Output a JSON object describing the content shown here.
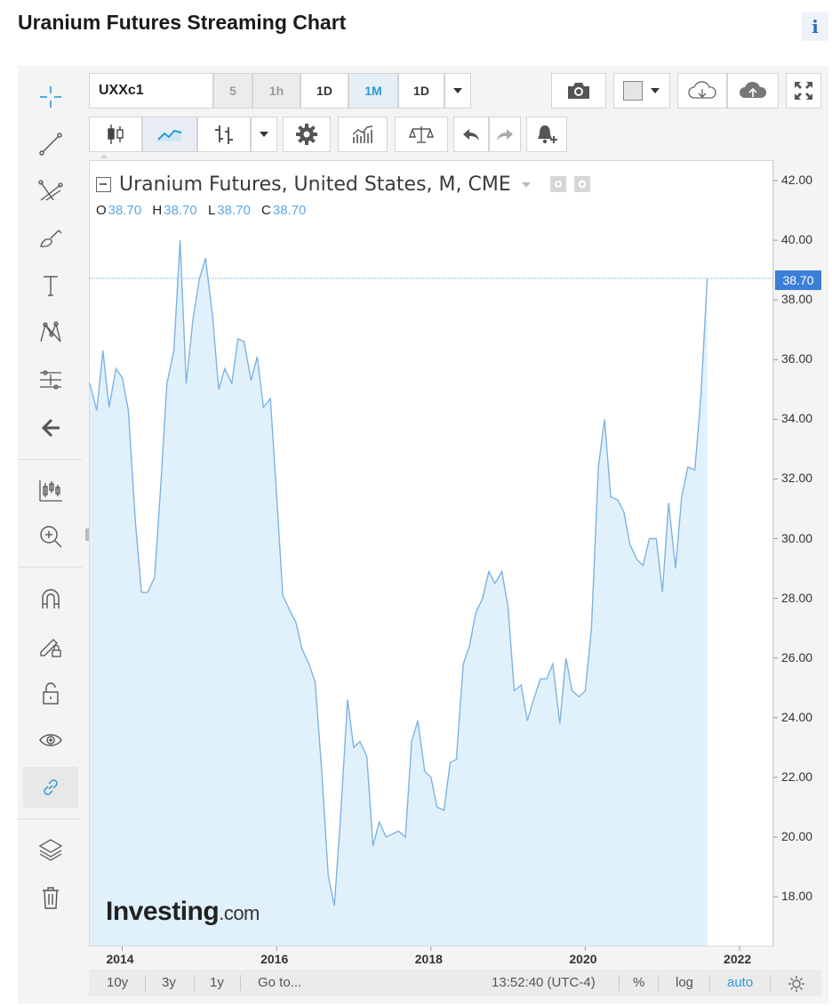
{
  "page": {
    "title": "Uranium Futures Streaming Chart",
    "info_label": "i"
  },
  "toolbar": {
    "symbol": "UXXc1",
    "intervals": [
      {
        "label": "5",
        "state": "disabled"
      },
      {
        "label": "1h",
        "state": "disabled"
      },
      {
        "label": "1D",
        "state": "normal"
      },
      {
        "label": "1M",
        "state": "selected"
      },
      {
        "label": "1D",
        "state": "normal"
      }
    ]
  },
  "legend": {
    "title": "Uranium Futures, United States, M, CME",
    "ohlc": [
      {
        "key": "O",
        "value": "38.70"
      },
      {
        "key": "H",
        "value": "38.70"
      },
      {
        "key": "L",
        "value": "38.70"
      },
      {
        "key": "C",
        "value": "38.70"
      }
    ]
  },
  "logo": {
    "main": "Investing",
    "suffix": ".com"
  },
  "bottom_bar": {
    "range_10y": "10y",
    "range_3y": "3y",
    "range_1y": "1y",
    "goto": "Go to...",
    "time": "13:52:40 (UTC-4)",
    "percent": "%",
    "log": "log",
    "auto": "auto"
  },
  "price_tag": "38.70",
  "colors": {
    "line": "#7db3e3",
    "fill": "#e1f1fb",
    "price_tag": "#3b7fd9",
    "accent": "#2b9bd6"
  },
  "chart_data": {
    "type": "area",
    "title": "Uranium Futures, United States, M, CME",
    "x_tick_labels": [
      "2014",
      "2016",
      "2018",
      "2020",
      "2022"
    ],
    "y_tick_labels": [
      "42.00",
      "40.00",
      "38.00",
      "36.00",
      "34.00",
      "32.00",
      "30.00",
      "28.00",
      "26.00",
      "24.00",
      "22.00",
      "20.00",
      "18.00"
    ],
    "ylim": [
      16.4,
      42.5
    ],
    "xlim": [
      2013.58,
      2022.2
    ],
    "grid": false,
    "series": [
      {
        "x": [
          2013.58,
          2013.67,
          2013.75,
          2013.83,
          2013.92,
          2014.0,
          2014.08,
          2014.17,
          2014.25,
          2014.33,
          2014.42,
          2014.5,
          2014.58,
          2014.67,
          2014.75,
          2014.83,
          2014.92,
          2015.0,
          2015.08,
          2015.17,
          2015.25,
          2015.33,
          2015.42,
          2015.5,
          2015.58,
          2015.67,
          2015.75,
          2015.83,
          2015.92,
          2016.0,
          2016.08,
          2016.17,
          2016.25,
          2016.33,
          2016.42,
          2016.5,
          2016.58,
          2016.67,
          2016.75,
          2016.83,
          2016.92,
          2017.0,
          2017.08,
          2017.17,
          2017.25,
          2017.33,
          2017.42,
          2017.5,
          2017.58,
          2017.67,
          2017.75,
          2017.83,
          2017.92,
          2018.0,
          2018.08,
          2018.17,
          2018.25,
          2018.33,
          2018.42,
          2018.5,
          2018.58,
          2018.67,
          2018.75,
          2018.83,
          2018.92,
          2019.0,
          2019.08,
          2019.17,
          2019.25,
          2019.33,
          2019.42,
          2019.5,
          2019.58,
          2019.67,
          2019.75,
          2019.83,
          2019.92,
          2020.0,
          2020.08,
          2020.17,
          2020.25,
          2020.33,
          2020.42,
          2020.5,
          2020.58,
          2020.67,
          2020.75,
          2020.83,
          2020.92,
          2021.0,
          2021.08,
          2021.17,
          2021.25,
          2021.33,
          2021.42,
          2021.5,
          2021.58
        ],
        "y": [
          35.2,
          34.3,
          36.3,
          34.4,
          35.7,
          35.4,
          34.3,
          30.6,
          28.2,
          28.2,
          28.7,
          31.8,
          35.2,
          36.3,
          40.0,
          35.2,
          37.4,
          38.7,
          39.4,
          37.5,
          35.0,
          35.7,
          35.2,
          36.7,
          36.6,
          35.3,
          36.1,
          34.4,
          34.7,
          31.5,
          28.1,
          27.6,
          27.2,
          26.3,
          25.8,
          25.2,
          22.4,
          18.7,
          17.7,
          20.7,
          24.6,
          23.0,
          23.2,
          22.7,
          19.7,
          20.5,
          20.0,
          20.1,
          20.2,
          20.0,
          23.2,
          23.9,
          22.2,
          22.0,
          21.0,
          20.9,
          22.5,
          22.6,
          25.8,
          26.4,
          27.5,
          28.0,
          28.9,
          28.5,
          28.9,
          27.7,
          24.9,
          25.1,
          23.9,
          24.6,
          25.3,
          25.3,
          25.8,
          23.8,
          26.0,
          24.9,
          24.7,
          24.9,
          27.0,
          32.4,
          34.0,
          31.4,
          31.3,
          30.9,
          29.8,
          29.3,
          29.1,
          30.0,
          30.0,
          28.2,
          31.2,
          29.0,
          31.4,
          32.4,
          32.3,
          34.8,
          38.7
        ]
      }
    ]
  }
}
